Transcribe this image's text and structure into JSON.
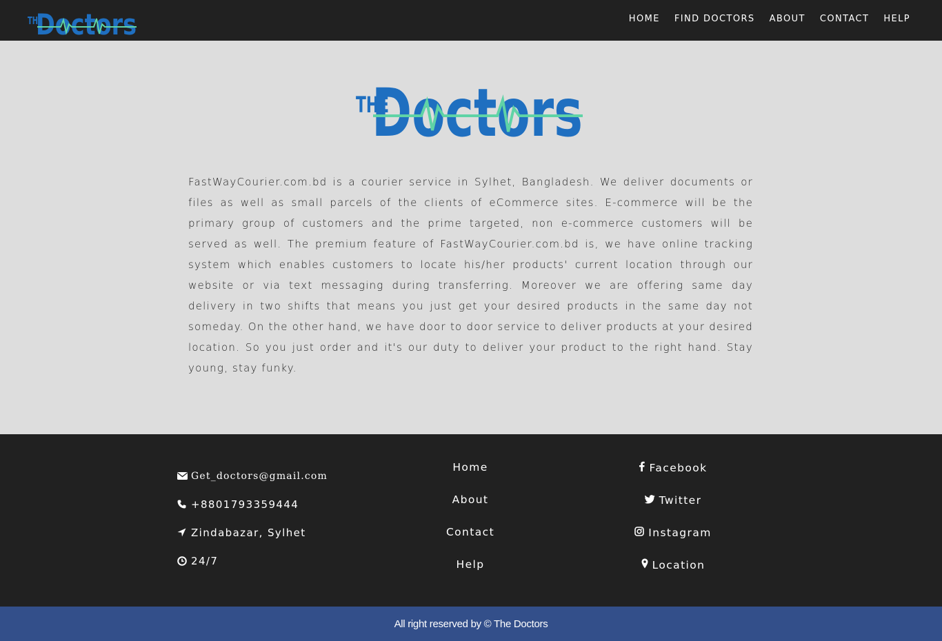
{
  "brand": {
    "name": "The Doctors",
    "logo_small": "THE Doctors",
    "logo_large": "THE Doctors"
  },
  "nav": {
    "items": [
      {
        "label": "HOME"
      },
      {
        "label": "FIND DOCTORS"
      },
      {
        "label": "ABOUT"
      },
      {
        "label": "CONTACT"
      },
      {
        "label": "HELP"
      }
    ]
  },
  "main": {
    "about_text": "FastWayCourier.com.bd is a courier service in Sylhet, Bangladesh. We deliver documents or files as well as small parcels of the clients of eCommerce sites. E-commerce will be the primary group of customers and the prime targeted, non e-commerce customers will be served as well. The premium feature of FastWayCourier.com.bd is, we have online tracking system which enables customers to locate his/her products' current location through our website or via text messaging during transferring. Moreover we are offering same day delivery in two shifts that means you just get your desired products in the same day not someday. On the other hand, we have door to door service to deliver products at your desired location. So you just order and it's our duty to deliver your product to the right hand. Stay young, stay funky."
  },
  "footer": {
    "contact": {
      "email": "Get_doctors@gmail.com",
      "phone": "+8801793359444",
      "address": "Zindabazar, Sylhet",
      "hours": "24/7"
    },
    "links": [
      {
        "label": "Home"
      },
      {
        "label": "About"
      },
      {
        "label": "Contact"
      },
      {
        "label": "Help"
      }
    ],
    "social": [
      {
        "label": "Facebook",
        "icon": "facebook-icon"
      },
      {
        "label": "Twitter",
        "icon": "twitter-icon"
      },
      {
        "label": "Instagram",
        "icon": "instagram-icon"
      },
      {
        "label": "Location",
        "icon": "map-pin-icon"
      }
    ],
    "copyright": "All right reserved by © The Doctors"
  },
  "colors": {
    "nav_bg": "#212121",
    "page_bg": "#dddddd",
    "footer_bg": "#212121",
    "copyright_bg": "#334f8a",
    "logo_blue": "#1f6fc0",
    "logo_green": "#5fd3a6"
  }
}
